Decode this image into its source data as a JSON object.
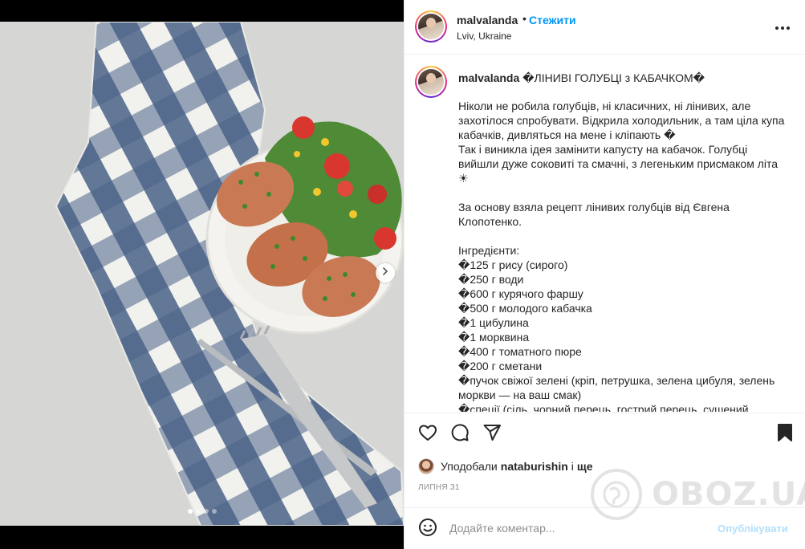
{
  "post": {
    "username": "malvalanda",
    "follow_label": "Стежити",
    "location": "Lviv, Ukraine",
    "title": "�ЛІНИВІ ГОЛУБЦІ з КАБАЧКОМ�",
    "body": "Ніколи не робила голубців, ні класичних, ні лінивих, але захотілося спробувати. Відкрила холодильник, а там ціла купа кабачків, дивляться на мене і кліпають �\nТак і виникла ідея замінити капусту на кабачок. Голубці вийшли дуже соковиті та смачні, з легеньким присмаком літа ☀\n\nЗа основу взяла рецепт лінивих голубців від Євгена Клопотенко.\n\nІнгредієнти:\n�125 г рису (сирого)\n�250 г води\n�600 г курячого фаршу\n�500 г молодого кабачка\n�1 цибулина\n�1 морквина\n�400 г томатного пюре\n�200 г сметани\n�пучок свіжої зелені (кріп, петрушка, зелена цибуля, зелень моркви — на ваш смак)\n�спеції (сіль, чорний перець, гострий перець, сушений",
    "likes_prefix": "Уподобали",
    "likes_user": "nataburishin",
    "likes_and": "і",
    "likes_more": "ще",
    "date": "ЛИПНЯ 31",
    "comment_placeholder": "Додайте коментар...",
    "publish_label": "Опублікувати"
  },
  "carousel": {
    "slides": 4,
    "current": 1
  },
  "icons": {
    "more": "more-horizontal-icon",
    "like": "heart-icon",
    "comment": "comment-icon",
    "share": "share-icon",
    "save": "bookmark-icon",
    "emoji": "emoji-icon",
    "next": "chevron-right-icon"
  },
  "watermark": "OBOZ.UA",
  "colors": {
    "link": "#0095f6",
    "publish_disabled": "#b2dffc",
    "muted": "#8e8e8e",
    "border": "#efefef"
  }
}
